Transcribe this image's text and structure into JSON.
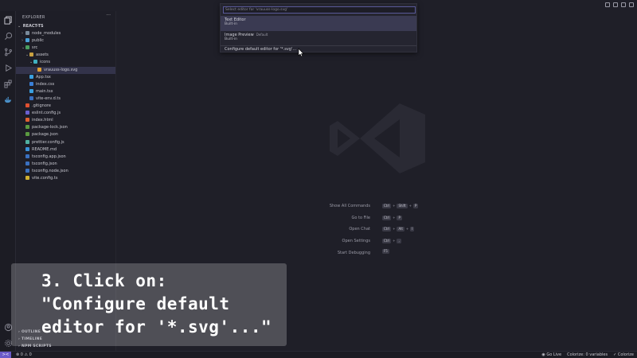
{
  "explorer": {
    "header": "EXPLORER",
    "more": "···",
    "root": "REACT-TS",
    "tree": [
      {
        "label": "node_modules",
        "type": "folder",
        "depth": 1,
        "chev": "›",
        "color": "#7a8a9a"
      },
      {
        "label": "public",
        "type": "folder",
        "depth": 1,
        "chev": "›",
        "color": "#4aa0d8"
      },
      {
        "label": "src",
        "type": "folder",
        "depth": 1,
        "chev": "⌄",
        "color": "#4aa060"
      },
      {
        "label": "assets",
        "type": "folder",
        "depth": 2,
        "chev": "⌄",
        "color": "#c8a040"
      },
      {
        "label": "icons",
        "type": "folder",
        "depth": 3,
        "chev": "⌄",
        "color": "#40b0c0"
      },
      {
        "label": "vrauuss-logo.svg",
        "type": "file",
        "depth": 4,
        "color": "#e0a030",
        "selected": true
      },
      {
        "label": "App.tsx",
        "type": "file",
        "depth": 2,
        "color": "#3aa0e0"
      },
      {
        "label": "index.css",
        "type": "file",
        "depth": 2,
        "color": "#3a80d8"
      },
      {
        "label": "main.tsx",
        "type": "file",
        "depth": 2,
        "color": "#3aa0e0"
      },
      {
        "label": "vite-env.d.ts",
        "type": "file",
        "depth": 2,
        "color": "#3a70c0"
      },
      {
        "label": ".gitignore",
        "type": "file",
        "depth": 1,
        "color": "#e05030"
      },
      {
        "label": "eslint.config.js",
        "type": "file",
        "depth": 1,
        "color": "#6a60d0"
      },
      {
        "label": "index.html",
        "type": "file",
        "depth": 1,
        "color": "#e06030"
      },
      {
        "label": "package-lock.json",
        "type": "file",
        "depth": 1,
        "color": "#5a9a40"
      },
      {
        "label": "package.json",
        "type": "file",
        "depth": 1,
        "color": "#5a9a40"
      },
      {
        "label": "prettier.config.js",
        "type": "file",
        "depth": 1,
        "color": "#50b0a0"
      },
      {
        "label": "README.md",
        "type": "file",
        "depth": 1,
        "color": "#3a90d8"
      },
      {
        "label": "tsconfig.app.json",
        "type": "file",
        "depth": 1,
        "color": "#3a70c0"
      },
      {
        "label": "tsconfig.json",
        "type": "file",
        "depth": 1,
        "color": "#3a70c0"
      },
      {
        "label": "tsconfig.node.json",
        "type": "file",
        "depth": 1,
        "color": "#3a70c0"
      },
      {
        "label": "vite.config.ts",
        "type": "file",
        "depth": 1,
        "color": "#d0b030"
      }
    ],
    "sections": [
      "OUTLINE",
      "TIMELINE",
      "NPM SCRIPTS"
    ]
  },
  "quickpick": {
    "placeholder": "Select editor for 'vrauuss-logo.svg'",
    "items": [
      {
        "title": "Text Editor",
        "sub": "Built-in",
        "desc": ""
      },
      {
        "title": "Image Preview",
        "sub": "Built-in",
        "desc": "Default"
      },
      {
        "title": "Configure default editor for '*.svg'...",
        "sub": "",
        "desc": ""
      }
    ]
  },
  "hints": [
    {
      "label": "Show All Commands",
      "keys": [
        "Ctrl",
        "Shift",
        "P"
      ]
    },
    {
      "label": "Go to File",
      "keys": [
        "Ctrl",
        "P"
      ]
    },
    {
      "label": "Open Chat",
      "keys": [
        "Ctrl",
        "Alt",
        "I"
      ]
    },
    {
      "label": "Open Settings",
      "keys": [
        "Ctrl",
        ","
      ]
    },
    {
      "label": "Start Debugging",
      "keys": [
        "F5"
      ]
    }
  ],
  "overlay": {
    "line1": "3. Click on:",
    "line2": "\"Configure default",
    "line3": "editor for '*.svg'...\""
  },
  "statusbar": {
    "remote": "><",
    "problems": "⊗ 0 ⚠ 0",
    "golive": "Go Live",
    "colorize_vars": "Colorize: 0 variables",
    "colorize": "Colorize"
  },
  "colors": {
    "accent": "#6a5ac8",
    "selection": "#33334a",
    "background": "#1f1f28"
  }
}
